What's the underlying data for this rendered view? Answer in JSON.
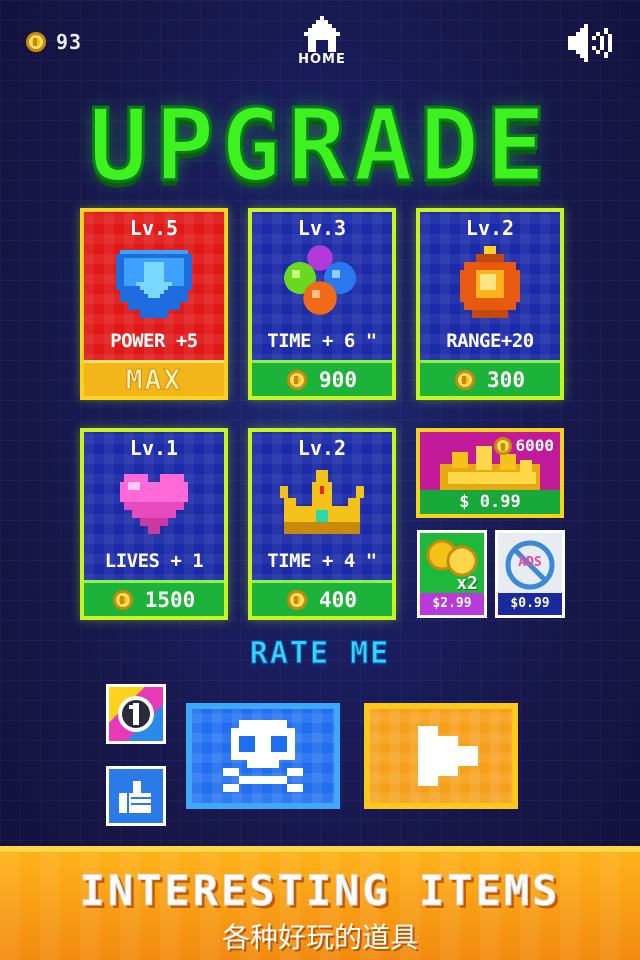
{
  "header": {
    "coins": "93",
    "home_label": "HOME"
  },
  "title": "UPGRADE",
  "upgrades": [
    {
      "level": "Lv.5",
      "effect": "POWER +5",
      "price": "MAX",
      "icon": "shield-icon",
      "maxed": true
    },
    {
      "level": "Lv.3",
      "effect": "TIME + 6 \"",
      "price": "900",
      "icon": "gems-icon"
    },
    {
      "level": "Lv.2",
      "effect": "RANGE+20",
      "price": "300",
      "icon": "bomb-icon"
    },
    {
      "level": "Lv.1",
      "effect": "LIVES + 1",
      "price": "1500",
      "icon": "heart-icon"
    },
    {
      "level": "Lv.2",
      "effect": "TIME + 4 \"",
      "price": "400",
      "icon": "crown-icon"
    }
  ],
  "store": {
    "coin_pack": {
      "amount": "6000",
      "price": "$ 0.99"
    },
    "double_coins": {
      "label": "x2",
      "price": "$2.99"
    },
    "remove_ads": {
      "label": "ADS",
      "price": "$0.99"
    }
  },
  "rate_me": "RATE ME",
  "banner": {
    "title": "INTERESTING ITEMS",
    "subtitle": "各种好玩的道具"
  },
  "colors": {
    "card_border": "#c6f51e",
    "card_bg": "#1a2aa8",
    "price_bar": "#1db33a",
    "title_green": "#3df21f"
  }
}
